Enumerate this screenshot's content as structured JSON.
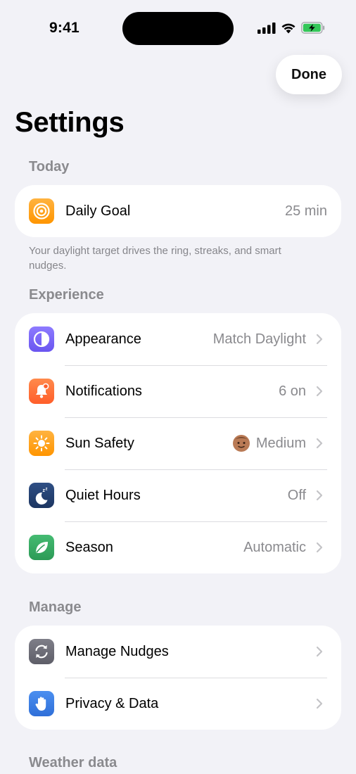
{
  "status_bar": {
    "time": "9:41"
  },
  "header": {
    "done_label": "Done",
    "title": "Settings"
  },
  "sections": {
    "today": {
      "title": "Today",
      "rows": [
        {
          "label": "Daily Goal",
          "value": "25 min",
          "icon": "target-icon",
          "color": "#ff9f0a"
        }
      ],
      "footer": "Your daylight target drives the ring, streaks, and smart nudges."
    },
    "experience": {
      "title": "Experience",
      "rows": [
        {
          "label": "Appearance",
          "value": "Match Daylight",
          "icon": "half-circle-icon",
          "color": "#7b61ff"
        },
        {
          "label": "Notifications",
          "value": "6 on",
          "icon": "bell-icon",
          "color": "#ff6b2c"
        },
        {
          "label": "Sun Safety",
          "value": "Medium",
          "icon": "sun-icon",
          "color": "#ff9f0a"
        },
        {
          "label": "Quiet Hours",
          "value": "Off",
          "icon": "moon-zzz-icon",
          "color": "#23406e"
        },
        {
          "label": "Season",
          "value": "Automatic",
          "icon": "leaf-icon",
          "color": "#34a861"
        }
      ]
    },
    "manage": {
      "title": "Manage",
      "rows": [
        {
          "label": "Manage Nudges",
          "icon": "arrows-cycle-icon",
          "color": "#6e6e78"
        },
        {
          "label": "Privacy & Data",
          "icon": "hand-icon",
          "color": "#3a7de0"
        }
      ]
    },
    "weather": {
      "title": "Weather data"
    }
  }
}
